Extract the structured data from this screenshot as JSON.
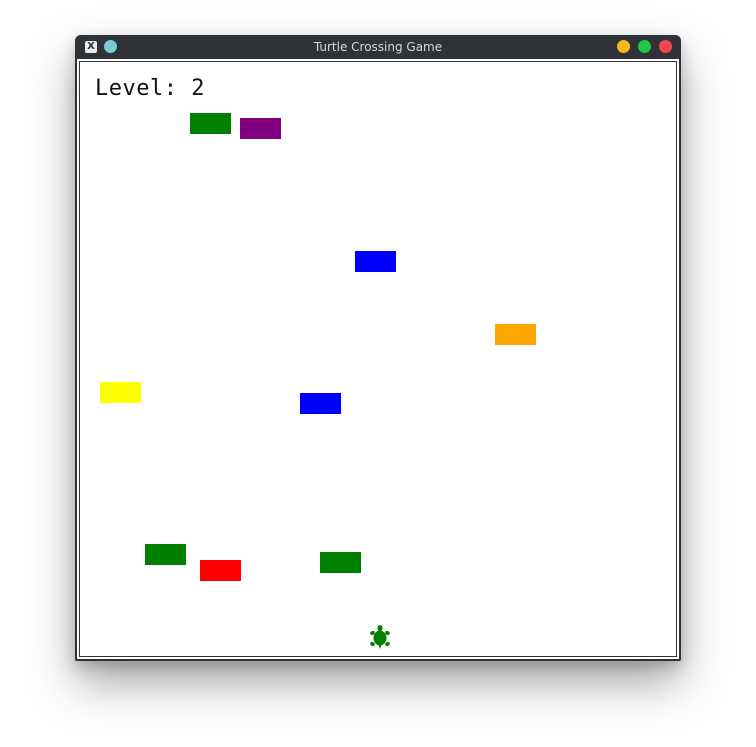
{
  "window": {
    "title": "Turtle Crossing Game",
    "app_icon": "X",
    "controls": [
      "pin",
      "minimize",
      "maximize",
      "close"
    ]
  },
  "colors": {
    "titlebar": "#2f3237",
    "minimize": "#f8b81b",
    "maximize": "#23c647",
    "close": "#f0484d",
    "pin": "#76cfd3"
  },
  "game": {
    "level_label": "Level:",
    "level_value": "2",
    "level_text": "Level: 2",
    "player": {
      "shape": "turtle-icon",
      "color": "#008000"
    },
    "cars": [
      {
        "color": "#008000"
      },
      {
        "color": "#800080"
      },
      {
        "color": "#0000ff"
      },
      {
        "color": "#ffa500"
      },
      {
        "color": "#ffff00"
      },
      {
        "color": "#0000ff"
      },
      {
        "color": "#008000"
      },
      {
        "color": "#ff0000"
      },
      {
        "color": "#008000"
      }
    ]
  }
}
